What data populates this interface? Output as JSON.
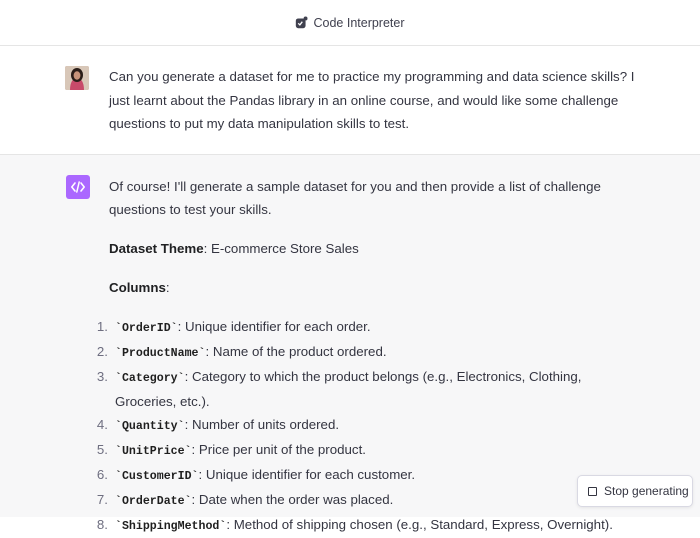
{
  "header": {
    "title": "Code Interpreter",
    "icon": "code-interpreter-icon"
  },
  "user_message": {
    "avatar": "user-avatar",
    "text": "Can you generate a dataset for me to practice my programming and data science skills? I just learnt about the Pandas library in an online course, and would like some challenge questions to put my data manipulation skills to test."
  },
  "assistant_message": {
    "icon": "code-brackets-icon",
    "intro": "Of course! I'll generate a sample dataset for you and then provide a list of challenge questions to test your skills.",
    "theme_label": "Dataset Theme",
    "theme_value": ": E-commerce Store Sales",
    "columns_label": "Columns",
    "columns_suffix": ":",
    "columns": [
      {
        "num": "1.",
        "name": "`OrderID`",
        "desc": ": Unique identifier for each order."
      },
      {
        "num": "2.",
        "name": "`ProductName`",
        "desc": ": Name of the product ordered."
      },
      {
        "num": "3.",
        "name": "`Category`",
        "desc": ": Category to which the product belongs (e.g., Electronics, Clothing, Groceries, etc.)."
      },
      {
        "num": "4.",
        "name": "`Quantity`",
        "desc": ": Number of units ordered."
      },
      {
        "num": "5.",
        "name": "`UnitPrice`",
        "desc": ": Price per unit of the product."
      },
      {
        "num": "6.",
        "name": "`CustomerID`",
        "desc": ": Unique identifier for each customer."
      },
      {
        "num": "7.",
        "name": "`OrderDate`",
        "desc": ": Date when the order was placed."
      },
      {
        "num": "8.",
        "name": "`ShippingMethod`",
        "desc": ": Method of shipping chosen (e.g., Standard, Express, Overnight)."
      }
    ]
  },
  "stop_button": {
    "label": "Stop generating"
  },
  "colors": {
    "accent": "#ab68ff",
    "assistant_bg": "#f7f7f8",
    "text": "#343541"
  }
}
